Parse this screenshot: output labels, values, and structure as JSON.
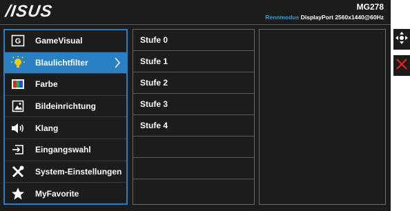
{
  "header": {
    "logo": "/ISUS",
    "model": "MG278",
    "mode_label": "Rennmodus",
    "signal_info": "DisplayPort 2560x1440@60Hz"
  },
  "menu": {
    "items": [
      {
        "label": "GameVisual",
        "icon": "game-visual-icon"
      },
      {
        "label": "Blaulichtfilter",
        "icon": "blue-light-icon",
        "active": true
      },
      {
        "label": "Farbe",
        "icon": "color-icon"
      },
      {
        "label": "Bildeinrichtung",
        "icon": "image-icon"
      },
      {
        "label": "Klang",
        "icon": "speaker-icon"
      },
      {
        "label": "Eingangswahl",
        "icon": "input-icon"
      },
      {
        "label": "System-Einstellungen",
        "icon": "tools-icon"
      },
      {
        "label": "MyFavorite",
        "icon": "star-icon"
      }
    ]
  },
  "submenu": {
    "items": [
      {
        "label": "Stufe 0"
      },
      {
        "label": "Stufe 1"
      },
      {
        "label": "Stufe 2"
      },
      {
        "label": "Stufe 3"
      },
      {
        "label": "Stufe 4"
      }
    ]
  },
  "side_buttons": {
    "move_icon": "move-icon",
    "close_icon": "close-icon"
  },
  "colors": {
    "accent": "#2b7fc3",
    "close": "#e02020",
    "background": "#1c1c1c"
  }
}
